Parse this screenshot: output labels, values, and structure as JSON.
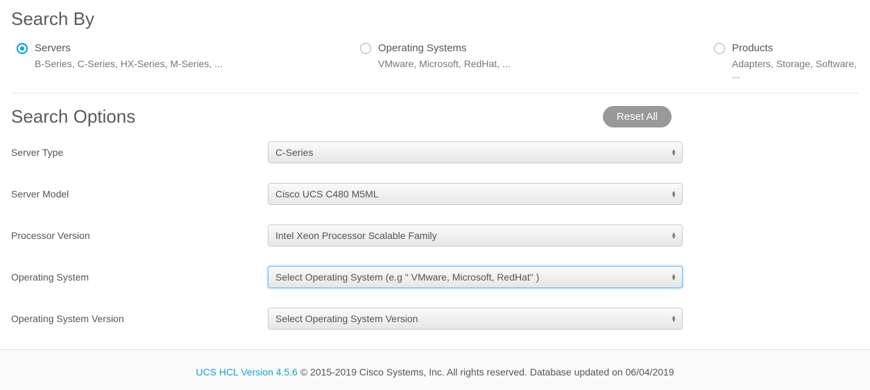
{
  "searchBy": {
    "title": "Search By",
    "options": [
      {
        "label": "Servers",
        "sub": "B-Series, C-Series, HX-Series, M-Series, ...",
        "selected": true
      },
      {
        "label": "Operating Systems",
        "sub": "VMware, Microsoft, RedHat, ...",
        "selected": false
      },
      {
        "label": "Products",
        "sub": "Adapters, Storage, Software, ...",
        "selected": false
      }
    ]
  },
  "searchOptions": {
    "title": "Search Options",
    "resetLabel": "Reset All",
    "fields": [
      {
        "label": "Server Type",
        "value": "C-Series",
        "focused": false
      },
      {
        "label": "Server Model",
        "value": "Cisco UCS C480 M5ML",
        "focused": false
      },
      {
        "label": "Processor Version",
        "value": "Intel Xeon Processor Scalable Family",
        "focused": false
      },
      {
        "label": "Operating System",
        "value": "Select Operating System (e.g \" VMware, Microsoft, RedHat\" )",
        "focused": true
      },
      {
        "label": "Operating System Version",
        "value": "Select Operating System Version",
        "focused": false
      }
    ]
  },
  "footer": {
    "versionLabel": "UCS HCL Version 4.5.6",
    "rest": " © 2015-2019 Cisco Systems, Inc. All rights reserved. Database updated on 06/04/2019"
  }
}
